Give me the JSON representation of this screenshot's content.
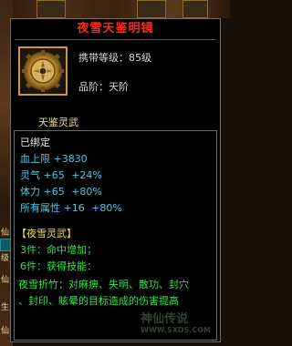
{
  "background": {
    "side_labels": [
      "仙",
      "级",
      "仙",
      "生",
      "仙"
    ]
  },
  "tooltip": {
    "title": "夜雪天鉴明镜",
    "item_icon": "gear-mirror-icon",
    "level_label": "携带等级：",
    "level_value": "85级",
    "quality_label": "品阶：",
    "quality_value": "天阶",
    "subtitle": "天鉴灵武",
    "bound": "已绑定",
    "stats": [
      {
        "name": "血上限",
        "value": "+3830",
        "extra": ""
      },
      {
        "name": "灵气",
        "value": "+65",
        "extra": "+24%"
      },
      {
        "name": "体力",
        "value": "+65",
        "extra": "+80%"
      },
      {
        "name": "所有属性",
        "value": "+16",
        "extra": "+80%"
      }
    ],
    "set_name": "【夜雪灵武】",
    "set_bonus_3": "3件：命中增加；",
    "set_bonus_6": "6件：获得技能：",
    "skill_line1": "夜雪折竹：对麻痹、失明、散功、封穴",
    "skill_line2": "、封印、眩晕的目标造成的伤害提高",
    "watermark": "神仙传说",
    "watermark_sub": "WWW.SXDS.COM"
  },
  "colors": {
    "title": "#ff2a1a",
    "stat_name": "#4ec8e8",
    "set_text": "#2ee84a",
    "set_name": "#f0e03a"
  }
}
